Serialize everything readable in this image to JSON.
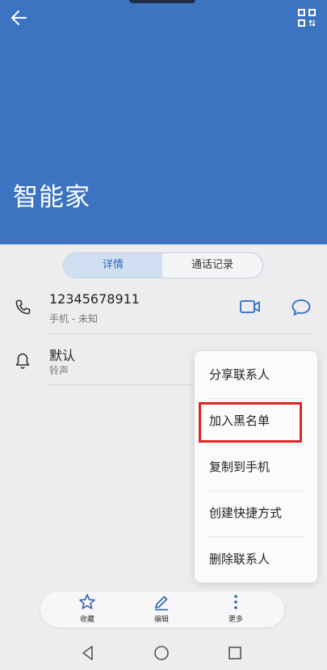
{
  "header": {
    "contact_name": "智能家",
    "background_color": "#3c74c2",
    "back_icon": "arrow-left-icon",
    "qr_icon": "qr-code-icon"
  },
  "tabs": [
    {
      "label": "详情",
      "selected": true
    },
    {
      "label": "通话记录",
      "selected": false
    }
  ],
  "phone": {
    "number": "12345678911",
    "type": "手机 - 未知",
    "icons": [
      "phone-icon",
      "video-call-icon",
      "message-icon"
    ]
  },
  "ringtone": {
    "value": "默认",
    "label": "铃声",
    "icon": "bell-icon"
  },
  "menu": {
    "items": [
      "分享联系人",
      "加入黑名单",
      "复制到手机",
      "创建快捷方式",
      "删除联系人"
    ],
    "highlighted_index": 1,
    "highlight_color": "#e02424"
  },
  "bottom_bar": {
    "favorite_label": "收藏",
    "edit_label": "编辑",
    "more_label": "更多",
    "accent_color": "#2f5fb3"
  },
  "nav": {
    "icons": [
      "nav-back-icon",
      "nav-home-icon",
      "nav-recents-icon"
    ]
  }
}
